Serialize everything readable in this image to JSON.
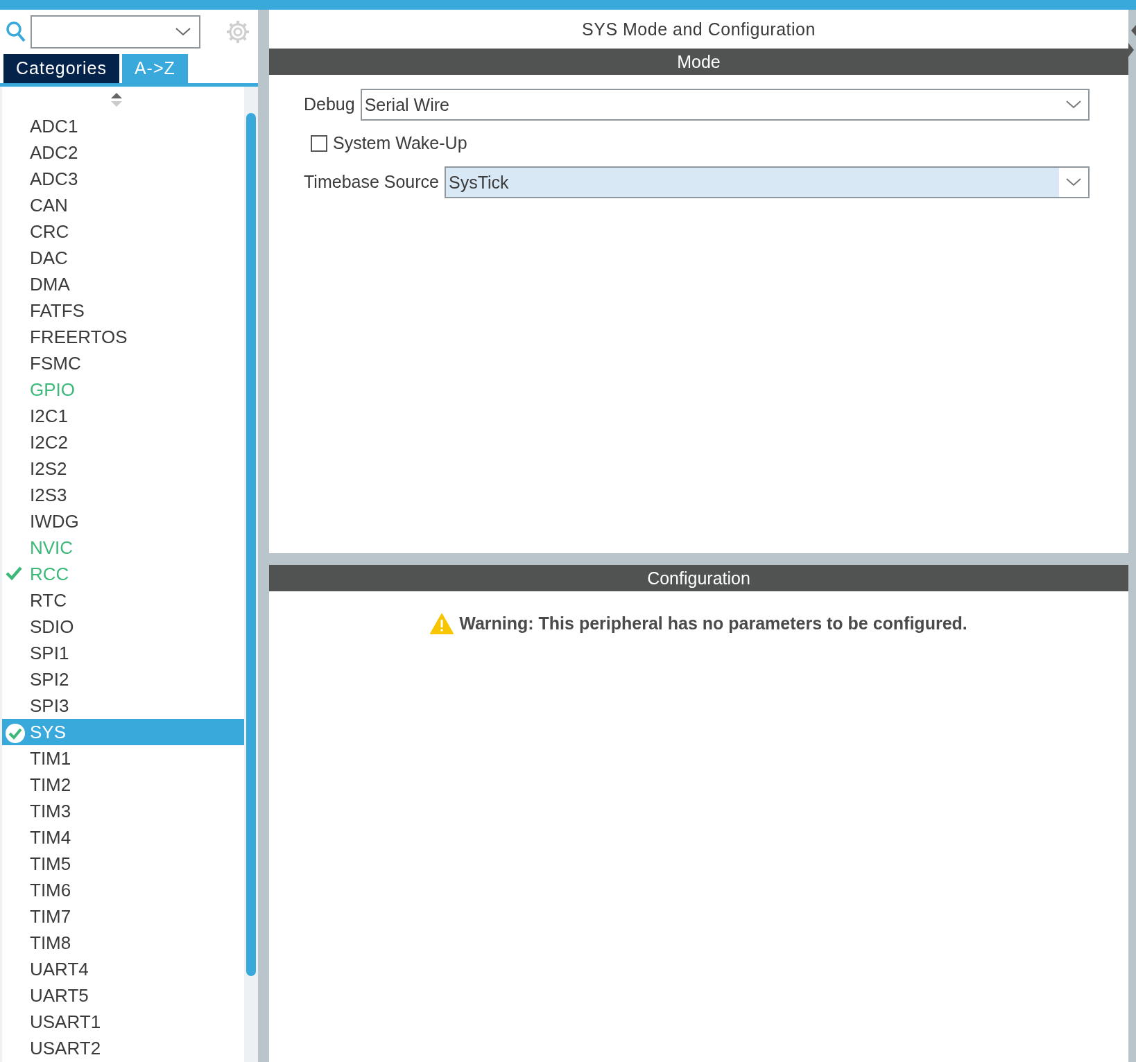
{
  "tabs": [
    {
      "label": "Categories",
      "selected": false
    },
    {
      "label": "A->Z",
      "selected": true
    }
  ],
  "peripherals": [
    {
      "name": "ADC1",
      "configured": false,
      "checked": false,
      "selected": false
    },
    {
      "name": "ADC2",
      "configured": false,
      "checked": false,
      "selected": false
    },
    {
      "name": "ADC3",
      "configured": false,
      "checked": false,
      "selected": false
    },
    {
      "name": "CAN",
      "configured": false,
      "checked": false,
      "selected": false
    },
    {
      "name": "CRC",
      "configured": false,
      "checked": false,
      "selected": false
    },
    {
      "name": "DAC",
      "configured": false,
      "checked": false,
      "selected": false
    },
    {
      "name": "DMA",
      "configured": false,
      "checked": false,
      "selected": false
    },
    {
      "name": "FATFS",
      "configured": false,
      "checked": false,
      "selected": false
    },
    {
      "name": "FREERTOS",
      "configured": false,
      "checked": false,
      "selected": false
    },
    {
      "name": "FSMC",
      "configured": false,
      "checked": false,
      "selected": false
    },
    {
      "name": "GPIO",
      "configured": true,
      "checked": false,
      "selected": false
    },
    {
      "name": "I2C1",
      "configured": false,
      "checked": false,
      "selected": false
    },
    {
      "name": "I2C2",
      "configured": false,
      "checked": false,
      "selected": false
    },
    {
      "name": "I2S2",
      "configured": false,
      "checked": false,
      "selected": false
    },
    {
      "name": "I2S3",
      "configured": false,
      "checked": false,
      "selected": false
    },
    {
      "name": "IWDG",
      "configured": false,
      "checked": false,
      "selected": false
    },
    {
      "name": "NVIC",
      "configured": true,
      "checked": false,
      "selected": false
    },
    {
      "name": "RCC",
      "configured": true,
      "checked": true,
      "selected": false
    },
    {
      "name": "RTC",
      "configured": false,
      "checked": false,
      "selected": false
    },
    {
      "name": "SDIO",
      "configured": false,
      "checked": false,
      "selected": false
    },
    {
      "name": "SPI1",
      "configured": false,
      "checked": false,
      "selected": false
    },
    {
      "name": "SPI2",
      "configured": false,
      "checked": false,
      "selected": false
    },
    {
      "name": "SPI3",
      "configured": false,
      "checked": false,
      "selected": false
    },
    {
      "name": "SYS",
      "configured": true,
      "checked": true,
      "selected": true
    },
    {
      "name": "TIM1",
      "configured": false,
      "checked": false,
      "selected": false
    },
    {
      "name": "TIM2",
      "configured": false,
      "checked": false,
      "selected": false
    },
    {
      "name": "TIM3",
      "configured": false,
      "checked": false,
      "selected": false
    },
    {
      "name": "TIM4",
      "configured": false,
      "checked": false,
      "selected": false
    },
    {
      "name": "TIM5",
      "configured": false,
      "checked": false,
      "selected": false
    },
    {
      "name": "TIM6",
      "configured": false,
      "checked": false,
      "selected": false
    },
    {
      "name": "TIM7",
      "configured": false,
      "checked": false,
      "selected": false
    },
    {
      "name": "TIM8",
      "configured": false,
      "checked": false,
      "selected": false
    },
    {
      "name": "UART4",
      "configured": false,
      "checked": false,
      "selected": false
    },
    {
      "name": "UART5",
      "configured": false,
      "checked": false,
      "selected": false
    },
    {
      "name": "USART1",
      "configured": false,
      "checked": false,
      "selected": false
    },
    {
      "name": "USART2",
      "configured": false,
      "checked": false,
      "selected": false
    }
  ],
  "panel_title": "SYS Mode and Configuration",
  "mode": {
    "header": "Mode",
    "debug": {
      "label": "Debug",
      "value": "Serial Wire",
      "highlighted": false
    },
    "wakeup": {
      "label": "System Wake-Up",
      "checked": false
    },
    "timebase": {
      "label": "Timebase Source",
      "value": "SysTick",
      "highlighted": true
    }
  },
  "configuration": {
    "header": "Configuration",
    "warning": "Warning: This peripheral has no parameters to be configured."
  }
}
